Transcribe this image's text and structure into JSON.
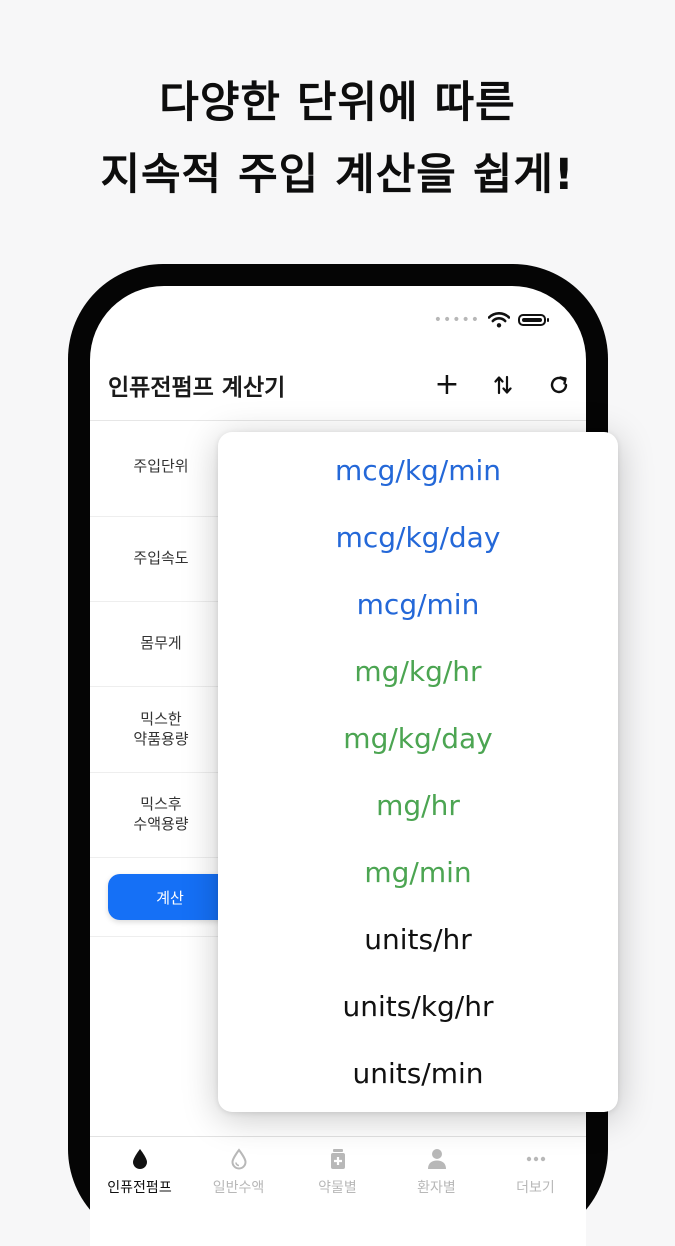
{
  "headline": {
    "line1": "다양한 단위에 따른",
    "line2": "지속적 주입 계산을 쉽게!"
  },
  "status": {
    "dots": "•••••"
  },
  "appbar": {
    "title": "인퓨전펌프 계산기",
    "add_label": "+"
  },
  "form": {
    "rows": [
      {
        "label": "주입단위"
      },
      {
        "label": "주입속도"
      },
      {
        "label": "몸무게"
      },
      {
        "label": "믹스한\n약품용량"
      },
      {
        "label": "믹스후\n수액용량"
      }
    ],
    "calc_label": "계산"
  },
  "dropdown": {
    "options": [
      {
        "label": "mcg/kg/min",
        "color": "#2468d8"
      },
      {
        "label": "mcg/kg/day",
        "color": "#2468d8"
      },
      {
        "label": "mcg/min",
        "color": "#2468d8"
      },
      {
        "label": "mg/kg/hr",
        "color": "#4ca552"
      },
      {
        "label": "mg/kg/day",
        "color": "#4ca552"
      },
      {
        "label": "mg/hr",
        "color": "#4ca552"
      },
      {
        "label": "mg/min",
        "color": "#4ca552"
      },
      {
        "label": "units/hr",
        "color": "#111111"
      },
      {
        "label": "units/kg/hr",
        "color": "#111111"
      },
      {
        "label": "units/min",
        "color": "#111111"
      }
    ]
  },
  "tabs": [
    {
      "label": "인퓨전펌프",
      "icon": "drop-filled-icon",
      "active": true
    },
    {
      "label": "일반수액",
      "icon": "drop-outline-icon",
      "active": false
    },
    {
      "label": "약물별",
      "icon": "medicine-bottle-icon",
      "active": false
    },
    {
      "label": "환자별",
      "icon": "person-icon",
      "active": false
    },
    {
      "label": "더보기",
      "icon": "more-dots-icon",
      "active": false
    }
  ],
  "colors": {
    "accent": "#1570f6",
    "blue_units": "#2468d8",
    "green_units": "#4ca552",
    "black_units": "#111111"
  }
}
